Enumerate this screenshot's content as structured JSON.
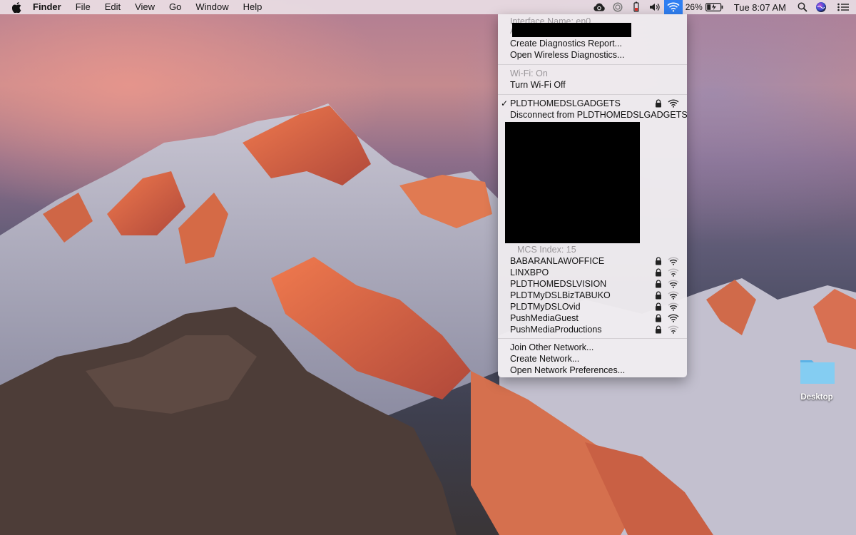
{
  "menubar": {
    "app_name": "Finder",
    "menus": [
      "File",
      "Edit",
      "View",
      "Go",
      "Window",
      "Help"
    ],
    "battery_percent": "26%",
    "clock": "Tue 8:07 AM"
  },
  "wifi_menu": {
    "interface_name": "Interface Name: en0",
    "address_prefix": "A",
    "create_diagnostics": "Create Diagnostics Report...",
    "open_wireless_diagnostics": "Open Wireless Diagnostics...",
    "wifi_status": "Wi-Fi: On",
    "turn_wifi_off": "Turn Wi-Fi Off",
    "connected_network": "PLDTHOMEDSLGADGETS",
    "disconnect": "Disconnect from PLDTHOMEDSLGADGETS",
    "mcs_index": "MCS Index: 15",
    "networks": [
      {
        "name": "BABARANLAWOFFICE",
        "strength": 3
      },
      {
        "name": "LINXBPO",
        "strength": 2
      },
      {
        "name": "PLDTHOMEDSLVISION",
        "strength": 3
      },
      {
        "name": "PLDTMyDSLBizTABUKO",
        "strength": 3
      },
      {
        "name": "PLDTMyDSLOvid",
        "strength": 3
      },
      {
        "name": "PushMediaGuest",
        "strength": 4
      },
      {
        "name": "PushMediaProductions",
        "strength": 2
      }
    ],
    "join_other": "Join Other Network...",
    "create_network": "Create Network...",
    "open_preferences": "Open Network Preferences..."
  },
  "desktop": {
    "folder_label": "Desktop"
  },
  "colors": {
    "menu_highlight": "#2f7ff2",
    "folder": "#7cc8f0"
  }
}
